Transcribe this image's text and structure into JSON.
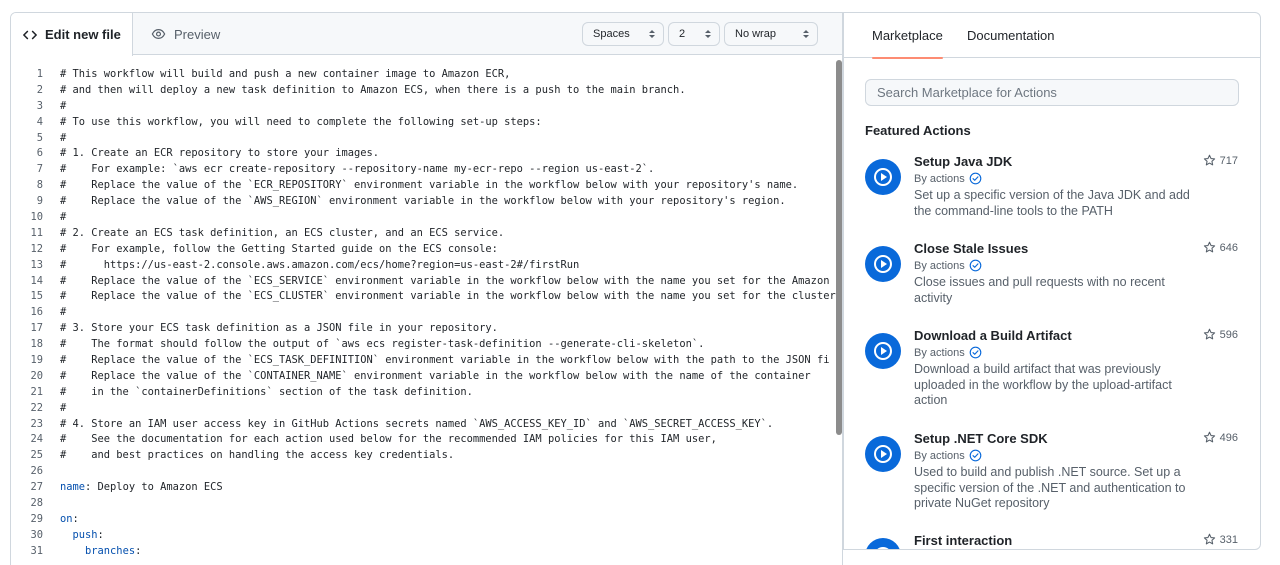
{
  "editor": {
    "tabs": {
      "edit_label": "Edit new file",
      "preview_label": "Preview"
    },
    "controls": {
      "indent_mode": "Spaces",
      "indent_size": "2",
      "wrap_mode": "No wrap"
    },
    "lines": [
      {
        "n": "1",
        "code": "# This workflow will build and push a new container image to Amazon ECR,"
      },
      {
        "n": "2",
        "code": "# and then will deploy a new task definition to Amazon ECS, when there is a push to the main branch."
      },
      {
        "n": "3",
        "code": "#"
      },
      {
        "n": "4",
        "code": "# To use this workflow, you will need to complete the following set-up steps:"
      },
      {
        "n": "5",
        "code": "#"
      },
      {
        "n": "6",
        "code": "# 1. Create an ECR repository to store your images."
      },
      {
        "n": "7",
        "code": "#    For example: `aws ecr create-repository --repository-name my-ecr-repo --region us-east-2`."
      },
      {
        "n": "8",
        "code": "#    Replace the value of the `ECR_REPOSITORY` environment variable in the workflow below with your repository's name."
      },
      {
        "n": "9",
        "code": "#    Replace the value of the `AWS_REGION` environment variable in the workflow below with your repository's region."
      },
      {
        "n": "10",
        "code": "#"
      },
      {
        "n": "11",
        "code": "# 2. Create an ECS task definition, an ECS cluster, and an ECS service."
      },
      {
        "n": "12",
        "code": "#    For example, follow the Getting Started guide on the ECS console:"
      },
      {
        "n": "13",
        "code": "#      https://us-east-2.console.aws.amazon.com/ecs/home?region=us-east-2#/firstRun"
      },
      {
        "n": "14",
        "code": "#    Replace the value of the `ECS_SERVICE` environment variable in the workflow below with the name you set for the Amazon"
      },
      {
        "n": "15",
        "code": "#    Replace the value of the `ECS_CLUSTER` environment variable in the workflow below with the name you set for the cluster"
      },
      {
        "n": "16",
        "code": "#"
      },
      {
        "n": "17",
        "code": "# 3. Store your ECS task definition as a JSON file in your repository."
      },
      {
        "n": "18",
        "code": "#    The format should follow the output of `aws ecs register-task-definition --generate-cli-skeleton`."
      },
      {
        "n": "19",
        "code": "#    Replace the value of the `ECS_TASK_DEFINITION` environment variable in the workflow below with the path to the JSON fi"
      },
      {
        "n": "20",
        "code": "#    Replace the value of the `CONTAINER_NAME` environment variable in the workflow below with the name of the container"
      },
      {
        "n": "21",
        "code": "#    in the `containerDefinitions` section of the task definition."
      },
      {
        "n": "22",
        "code": "#"
      },
      {
        "n": "23",
        "code": "# 4. Store an IAM user access key in GitHub Actions secrets named `AWS_ACCESS_KEY_ID` and `AWS_SECRET_ACCESS_KEY`."
      },
      {
        "n": "24",
        "code": "#    See the documentation for each action used below for the recommended IAM policies for this IAM user,"
      },
      {
        "n": "25",
        "code": "#    and best practices on handling the access key credentials."
      },
      {
        "n": "26",
        "code": ""
      },
      {
        "n": "27",
        "key": "name",
        "rest": ": Deploy to Amazon ECS"
      },
      {
        "n": "28",
        "code": ""
      },
      {
        "n": "29",
        "key": "on",
        "rest": ":"
      },
      {
        "n": "30",
        "indent": "  ",
        "key": "push",
        "rest": ":"
      },
      {
        "n": "31",
        "indent": "    ",
        "key": "branches",
        "rest": ":"
      }
    ]
  },
  "sidebar": {
    "tabs": {
      "marketplace": "Marketplace",
      "documentation": "Documentation"
    },
    "search_placeholder": "Search Marketplace for Actions",
    "featured_title": "Featured Actions",
    "actions": [
      {
        "name": "Setup Java JDK",
        "by": "By actions",
        "description": "Set up a specific version of the Java JDK and add the command-line tools to the PATH",
        "stars": "717"
      },
      {
        "name": "Close Stale Issues",
        "by": "By actions",
        "description": "Close issues and pull requests with no recent activity",
        "stars": "646"
      },
      {
        "name": "Download a Build Artifact",
        "by": "By actions",
        "description": "Download a build artifact that was previously uploaded in the workflow by the upload-artifact action",
        "stars": "596"
      },
      {
        "name": "Setup .NET Core SDK",
        "by": "By actions",
        "description": "Used to build and publish .NET source. Set up a specific version of the .NET and authentication to private NuGet repository",
        "stars": "496"
      },
      {
        "name": "First interaction",
        "by": "By actions",
        "description": "",
        "stars": "331"
      }
    ]
  },
  "colors": {
    "accent_blue": "#0969da",
    "tab_underline": "#fd8c73",
    "yaml_key": "#0550ae",
    "verified_green": "#1a7f37"
  }
}
